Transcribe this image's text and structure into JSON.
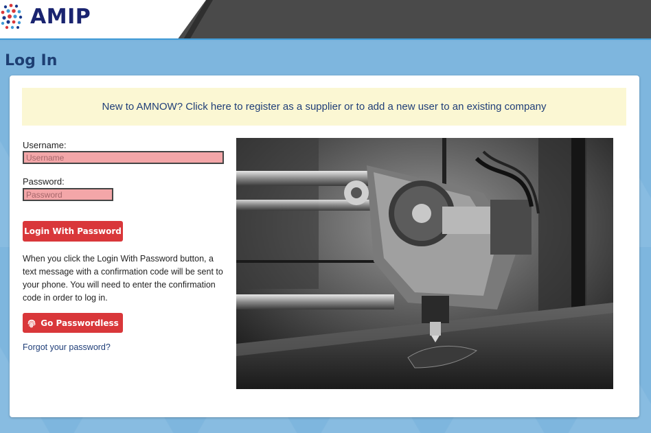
{
  "header": {
    "logo_text": "AMIP"
  },
  "page": {
    "title": "Log In"
  },
  "notice": {
    "text": "New to AMNOW? Click here to register as a supplier or to add a new user to an existing company"
  },
  "form": {
    "username_label": "Username:",
    "username_placeholder": "Username",
    "username_value": "",
    "password_label": "Password:",
    "password_placeholder": "Password",
    "password_value": "",
    "login_button": "Login With Password",
    "info_text": "When you click the Login With Password button, a text message with a confirmation code will be sent to your phone. You will need to enter the confirmation code in order to log in.",
    "passwordless_button": "Go Passwordless",
    "passwordless_icon": "fingerprint-icon",
    "forgot_link": "Forgot your password?"
  },
  "colors": {
    "header_dark": "#4a4a4a",
    "header_accent": "#3f9ad6",
    "brand_navy": "#1a2470",
    "background_blue": "#7eb6de",
    "button_red": "#d9373a",
    "notice_bg": "#fbf7d3",
    "input_error_bg": "#f3a6a8"
  }
}
